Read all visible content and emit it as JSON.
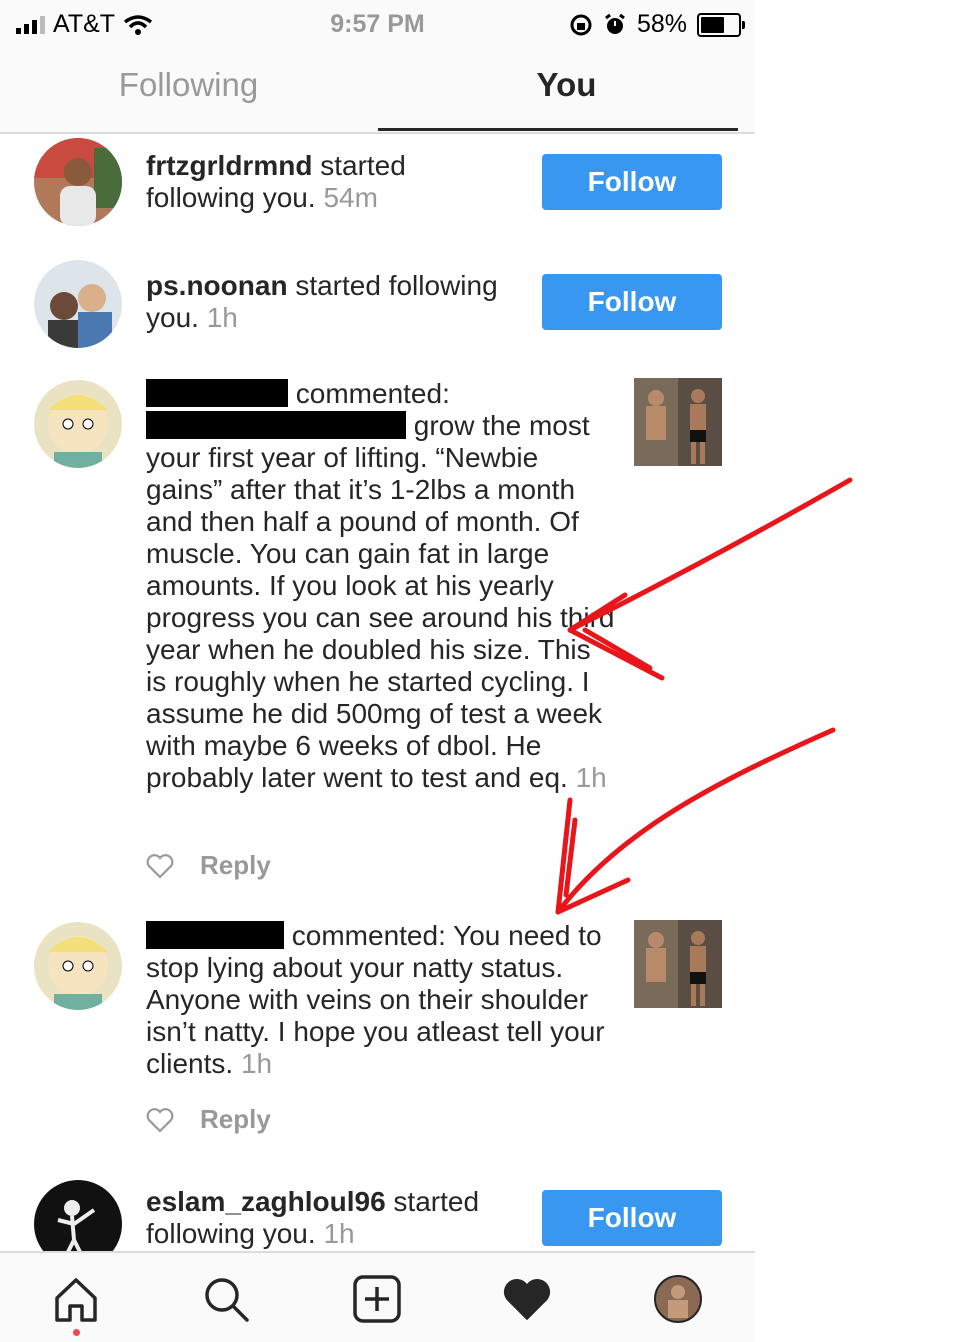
{
  "status_bar": {
    "carrier": "AT&T",
    "time": "9:57 PM",
    "battery": "58%"
  },
  "tabs": {
    "following": "Following",
    "you": "You"
  },
  "notifications": [
    {
      "username": "frtzgrldrmnd",
      "action": " started following you.",
      "time": "54m",
      "button": "Follow"
    },
    {
      "username": "ps.noonan",
      "action": " started following you.",
      "time": "1h",
      "button": "Follow"
    },
    {
      "action": "commented:",
      "line2_suffix": " grow the most",
      "body": "your first year of lifting. “Newbie gains” after that it’s 1-2lbs a month and then half a pound of month. Of muscle. You can gain fat in large amounts. If you look at his yearly progress you can see around his third year when he doubled his size. This is roughly when he started cycling. I assume he did 500mg of test a week with maybe 6 weeks of dbol. He probably later went to test and eq.",
      "time": "1h",
      "reply": "Reply"
    },
    {
      "action": "commented: You need to stop lying about your natty status. Anyone with veins on their shoulder isn’t natty. I hope you atleast tell your clients.",
      "time": "1h",
      "reply": "Reply"
    },
    {
      "username": "eslam_zaghloul96",
      "action": " started following you.",
      "time": "1h",
      "button": "Follow"
    }
  ],
  "bottom_nav": [
    "home-icon",
    "search-icon",
    "add-post-icon",
    "activity-heart-icon",
    "profile-avatar"
  ],
  "colors": {
    "follow": "#3897f0",
    "annotation_arrow": "#e8161b",
    "notification_dot": "#ed4956"
  }
}
